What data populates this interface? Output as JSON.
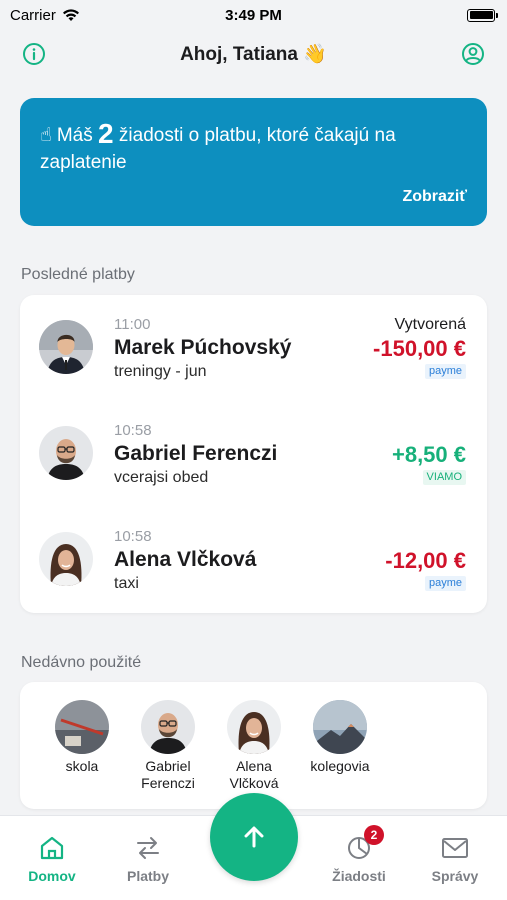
{
  "status_bar": {
    "carrier": "Carrier",
    "time": "3:49 PM"
  },
  "header": {
    "title": "Ahoj, Tatiana 👋"
  },
  "banner": {
    "emoji": "☝",
    "text_before": "Máš",
    "count": "2",
    "text_after": "žiadosti o platbu, ktoré čakajú na zaplatenie",
    "link": "Zobraziť"
  },
  "payments": {
    "label": "Posledné platby",
    "items": [
      {
        "time": "11:00",
        "name": "Marek Púchovský",
        "note": "treningy - jun",
        "status": "Vytvorená",
        "amount": "-150,00 €",
        "badge": "payme",
        "sign": "neg"
      },
      {
        "time": "10:58",
        "name": "Gabriel Ferenczi",
        "note": "vcerajsi obed",
        "status": "",
        "amount": "+8,50 €",
        "badge": "VIAMO",
        "sign": "pos"
      },
      {
        "time": "10:58",
        "name": "Alena Vlčková",
        "note": "taxi",
        "status": "",
        "amount": "-12,00 €",
        "badge": "payme",
        "sign": "neg"
      }
    ]
  },
  "recent": {
    "label": "Nedávno použité",
    "items": [
      {
        "label": "skola"
      },
      {
        "label": "Gabriel Ferenczi"
      },
      {
        "label": "Alena Vlčková"
      },
      {
        "label": "kolegovia"
      }
    ]
  },
  "tabbar": {
    "tabs": [
      {
        "label": "Domov",
        "active": true
      },
      {
        "label": "Platby"
      },
      {
        "label": "Žiadosti",
        "badge": "2"
      },
      {
        "label": "Správy"
      }
    ]
  },
  "colors": {
    "accent": "#14b484",
    "banner": "#0d8fbf",
    "negative": "#d0122a",
    "positive": "#17b07a"
  }
}
